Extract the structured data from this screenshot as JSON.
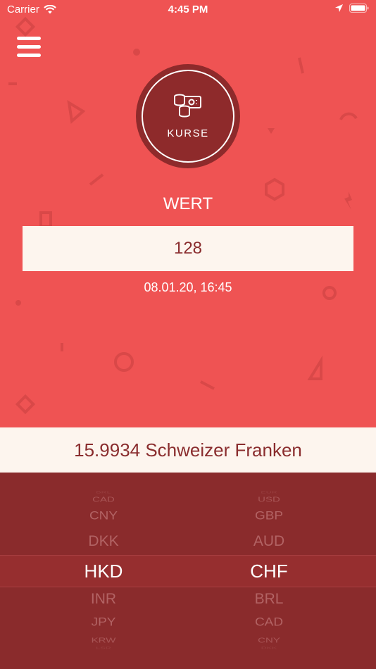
{
  "status_bar": {
    "carrier": "Carrier",
    "time": "4:45 PM"
  },
  "badge": {
    "label": "KURSE",
    "icon": "coins-cash-icon"
  },
  "wert_label": "WERT",
  "value_input": {
    "value": "128"
  },
  "datetime": "08.01.20, 16:45",
  "result": "15.9934 Schweizer Franken",
  "picker": {
    "left": [
      "BRL",
      "CAD",
      "CNY",
      "DKK",
      "HKD",
      "INR",
      "JPY",
      "KRW",
      "LSR"
    ],
    "right": [
      "EUR",
      "USD",
      "GBP",
      "AUD",
      "CHF",
      "BRL",
      "CAD",
      "CNY",
      "DKK"
    ],
    "selected_index": 4
  },
  "colors": {
    "background": "#EF5353",
    "accent_dark": "#8E2A2B",
    "cream": "#FDF5EE",
    "text_dark": "#8A2D2E"
  }
}
